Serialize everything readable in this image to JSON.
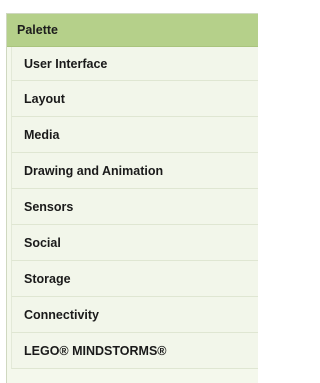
{
  "palette": {
    "title": "Palette",
    "categories": [
      {
        "label": "User Interface"
      },
      {
        "label": "Layout"
      },
      {
        "label": "Media"
      },
      {
        "label": "Drawing and Animation"
      },
      {
        "label": "Sensors"
      },
      {
        "label": "Social"
      },
      {
        "label": "Storage"
      },
      {
        "label": "Connectivity"
      },
      {
        "label": "LEGO® MINDSTORMS®"
      }
    ]
  },
  "colors": {
    "header_bg": "#b5d08a",
    "item_bg": "#f2f6ea",
    "divider": "#dfe6d2"
  }
}
